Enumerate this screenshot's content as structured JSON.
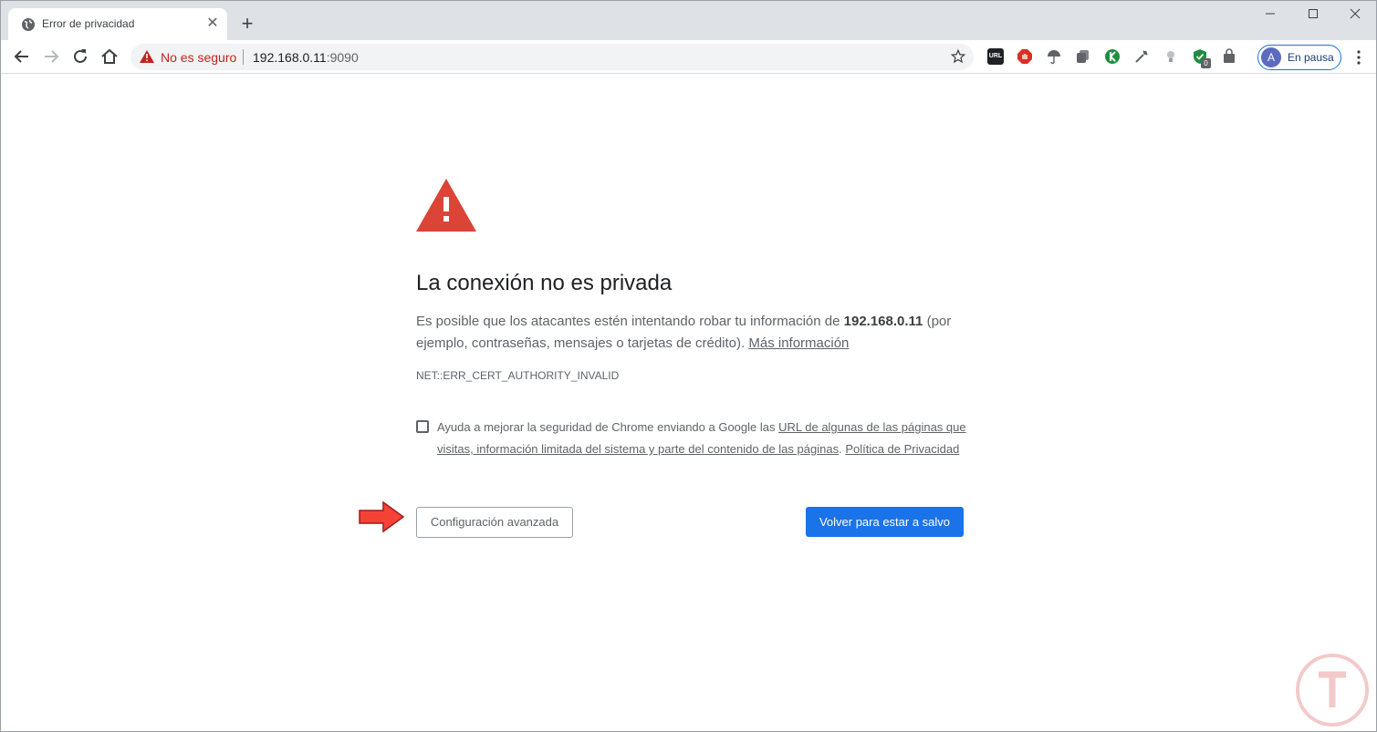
{
  "window": {
    "minimize_icon": "minimize-icon",
    "maximize_icon": "maximize-icon",
    "close_icon": "close-icon"
  },
  "tab": {
    "title": "Error de privacidad",
    "favicon": "globe-icon",
    "close": "✕",
    "new_tab": "+"
  },
  "toolbar": {
    "security_label": "No es seguro",
    "url_host": "192.168.0.11",
    "url_port": ":9090",
    "profile_initial": "A",
    "profile_label": "En pausa",
    "extensions": [
      {
        "name": "url-shortener-icon",
        "text": "URL",
        "color": "#202124"
      },
      {
        "name": "adblock-icon",
        "text": "",
        "color": "#d93025"
      },
      {
        "name": "umbrella-icon",
        "text": "",
        "color": "#5f6368"
      },
      {
        "name": "copy-icon",
        "text": "",
        "color": "#5f6368"
      },
      {
        "name": "k-extension-icon",
        "text": "K",
        "color": "#1e8e3e"
      },
      {
        "name": "pipette-icon",
        "text": "",
        "color": "#5f6368"
      },
      {
        "name": "bulb-icon",
        "text": "",
        "color": "#9aa0a6"
      },
      {
        "name": "shield-check-icon",
        "text": "0",
        "color": "#1e8e3e"
      },
      {
        "name": "bag-icon",
        "text": "",
        "color": "#5f6368"
      }
    ]
  },
  "page": {
    "heading": "La conexión no es privada",
    "para_before": "Es posible que los atacantes estén intentando robar tu información de ",
    "para_host": "192.168.0.11",
    "para_after": " (por ejemplo, contraseñas, mensajes o tarjetas de crédito). ",
    "para_link": "Más información",
    "error_code": "NET::ERR_CERT_AUTHORITY_INVALID",
    "optin_before": "Ayuda a mejorar la seguridad de Chrome enviando a Google las ",
    "optin_link": "URL de algunas de las páginas que visitas, información limitada del sistema y parte del contenido de las páginas",
    "optin_sep": ". ",
    "optin_privacy": "Política de Privacidad",
    "advanced_button": "Configuración avanzada",
    "back_button": "Volver para estar a salvo"
  },
  "colors": {
    "accent": "#1a73e8",
    "danger": "#c5221f",
    "warning_icon": "#db4437"
  }
}
